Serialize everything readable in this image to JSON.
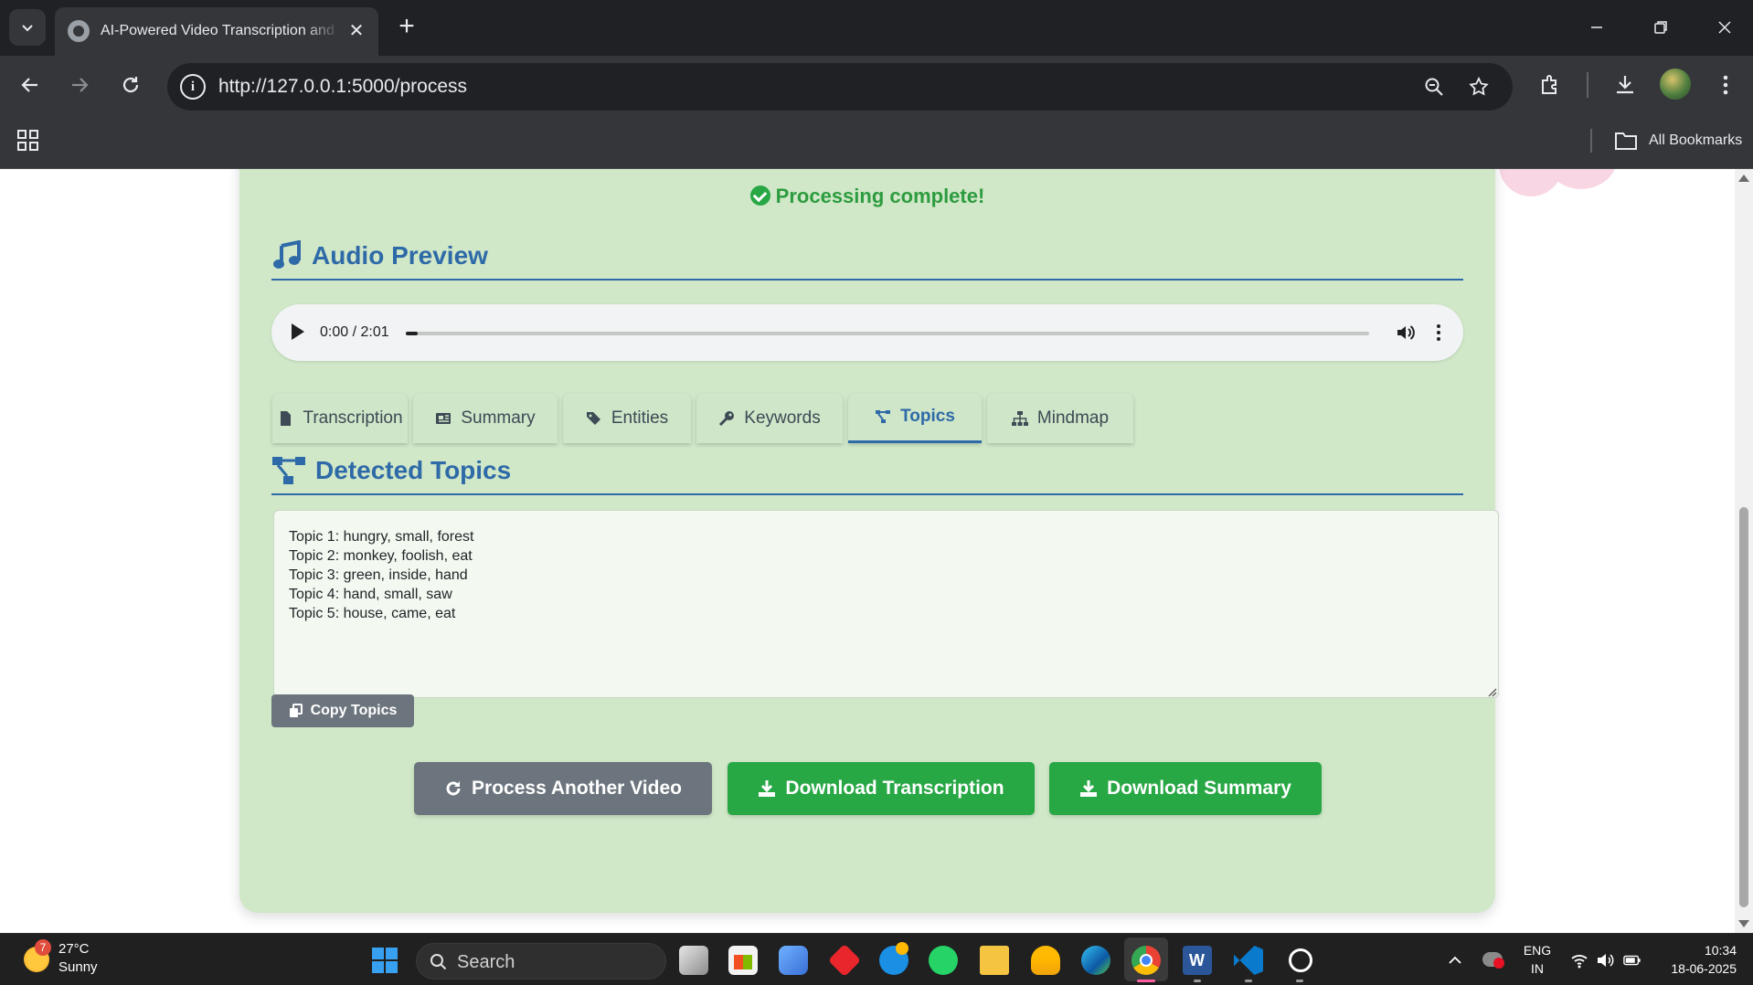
{
  "browser": {
    "tab_title": "AI-Powered Video Transcription and Summarization",
    "url": "http://127.0.0.1:5000/process",
    "bookmarks_label": "All Bookmarks"
  },
  "page": {
    "status": "Processing complete!",
    "audio_section_title": "Audio Preview",
    "audio": {
      "time": "0:00 / 2:01",
      "progress": 0.01
    },
    "tabs": [
      {
        "label": "Transcription",
        "icon": "file-icon"
      },
      {
        "label": "Summary",
        "icon": "newspaper-icon"
      },
      {
        "label": "Entities",
        "icon": "tags-icon"
      },
      {
        "label": "Keywords",
        "icon": "key-icon"
      },
      {
        "label": "Topics",
        "icon": "project-diagram-icon",
        "active": true
      },
      {
        "label": "Mindmap",
        "icon": "sitemap-icon"
      }
    ],
    "topics_section_title": "Detected Topics",
    "topics_text": "Topic 1: hungry, small, forest\nTopic 2: monkey, foolish, eat\nTopic 3: green, inside, hand\nTopic 4: hand, small, saw\nTopic 5: house, came, eat",
    "copy_button": "Copy Topics",
    "actions": {
      "process_another": "Process Another Video",
      "download_transcription": "Download Transcription",
      "download_summary": "Download Summary"
    },
    "colors": {
      "card_bg": "#d0e8c8",
      "accent_blue": "#2f6aa8",
      "success_green": "#28a745",
      "grey_button": "#6c757d"
    }
  },
  "taskbar": {
    "weather": {
      "temp": "27°C",
      "desc": "Sunny",
      "badge": "7"
    },
    "search_label": "Search",
    "language": "ENG",
    "region": "IN",
    "time": "10:34",
    "date": "18-06-2025"
  }
}
